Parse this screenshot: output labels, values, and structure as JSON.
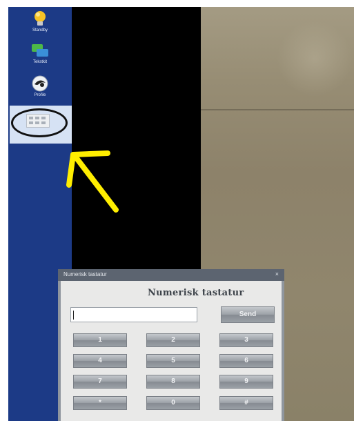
{
  "sidebar": {
    "items": [
      {
        "label": "Standby",
        "icon": "lightbulb-icon"
      },
      {
        "label": "Tekstkit",
        "icon": "chat-icon"
      },
      {
        "label": "Profile",
        "icon": "logo-icon"
      },
      {
        "label": "",
        "icon": "keyboard-icon"
      }
    ]
  },
  "annotation": {
    "arrow_color": "#ffee00",
    "oval_color": "#111111"
  },
  "dialog": {
    "title": "Numerisk tastatur",
    "close": "×",
    "heading": "Numerisk tastatur",
    "input_value": "",
    "send_label": "Send",
    "keys": [
      "1",
      "2",
      "3",
      "4",
      "5",
      "6",
      "7",
      "8",
      "9",
      "*",
      "0",
      "#"
    ]
  }
}
